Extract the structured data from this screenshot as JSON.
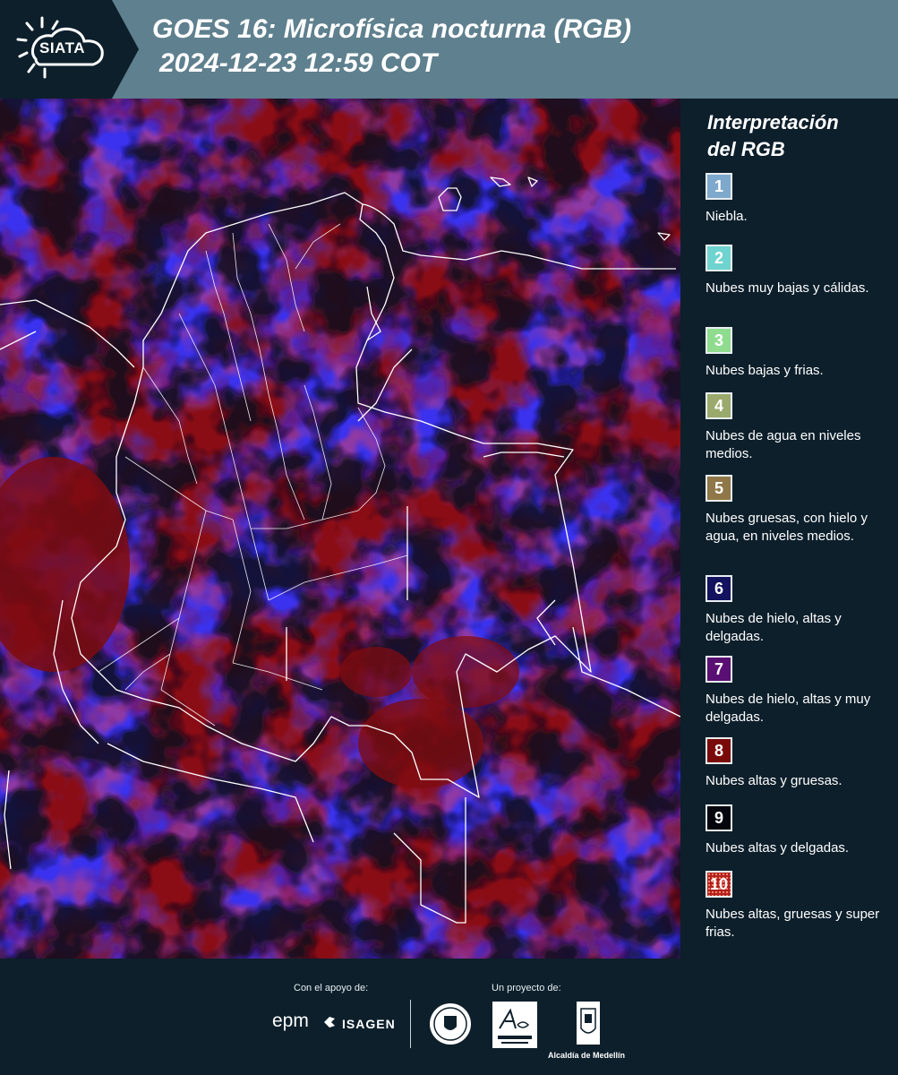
{
  "header": {
    "logo_text": "SIATA",
    "title_line1": "GOES 16: Microfísica nocturna (RGB)",
    "title_line2": "2024-12-23 12:59 COT"
  },
  "legend": {
    "title_line1": "Interpretación",
    "title_line2": "del RGB",
    "items": [
      {
        "number": "1",
        "label": "Niebla.",
        "color": "#7fa9cc"
      },
      {
        "number": "2",
        "label": "Nubes muy bajas y cálidas.",
        "color": "#6fd3cf"
      },
      {
        "number": "3",
        "label": "Nubes bajas y frias.",
        "color": "#8fdc8f"
      },
      {
        "number": "4",
        "label": "Nubes de agua en niveles medios.",
        "color": "#9aaa6c"
      },
      {
        "number": "5",
        "label": "Nubes gruesas, con hielo y agua, en niveles medios.",
        "color": "#8f7748"
      },
      {
        "number": "6",
        "label": "Nubes de hielo, altas y delgadas.",
        "color": "#12125e"
      },
      {
        "number": "7",
        "label": "Nubes de hielo, altas y muy delgadas.",
        "color": "#5a0f72"
      },
      {
        "number": "8",
        "label": "Nubes altas y gruesas.",
        "color": "#7a0a0a"
      },
      {
        "number": "9",
        "label": "Nubes altas y delgadas.",
        "color": "#05050e"
      },
      {
        "number": "10",
        "label": "Nubes altas, gruesas y super frias.",
        "color": "#b0231b"
      }
    ]
  },
  "footer": {
    "support_caption": "Con el apoyo de:",
    "project_caption": "Un proyecto de:",
    "epm_text": "epm",
    "isagen_text": "ISAGEN",
    "alcaldia_text": "Alcaldía de Medellín"
  }
}
